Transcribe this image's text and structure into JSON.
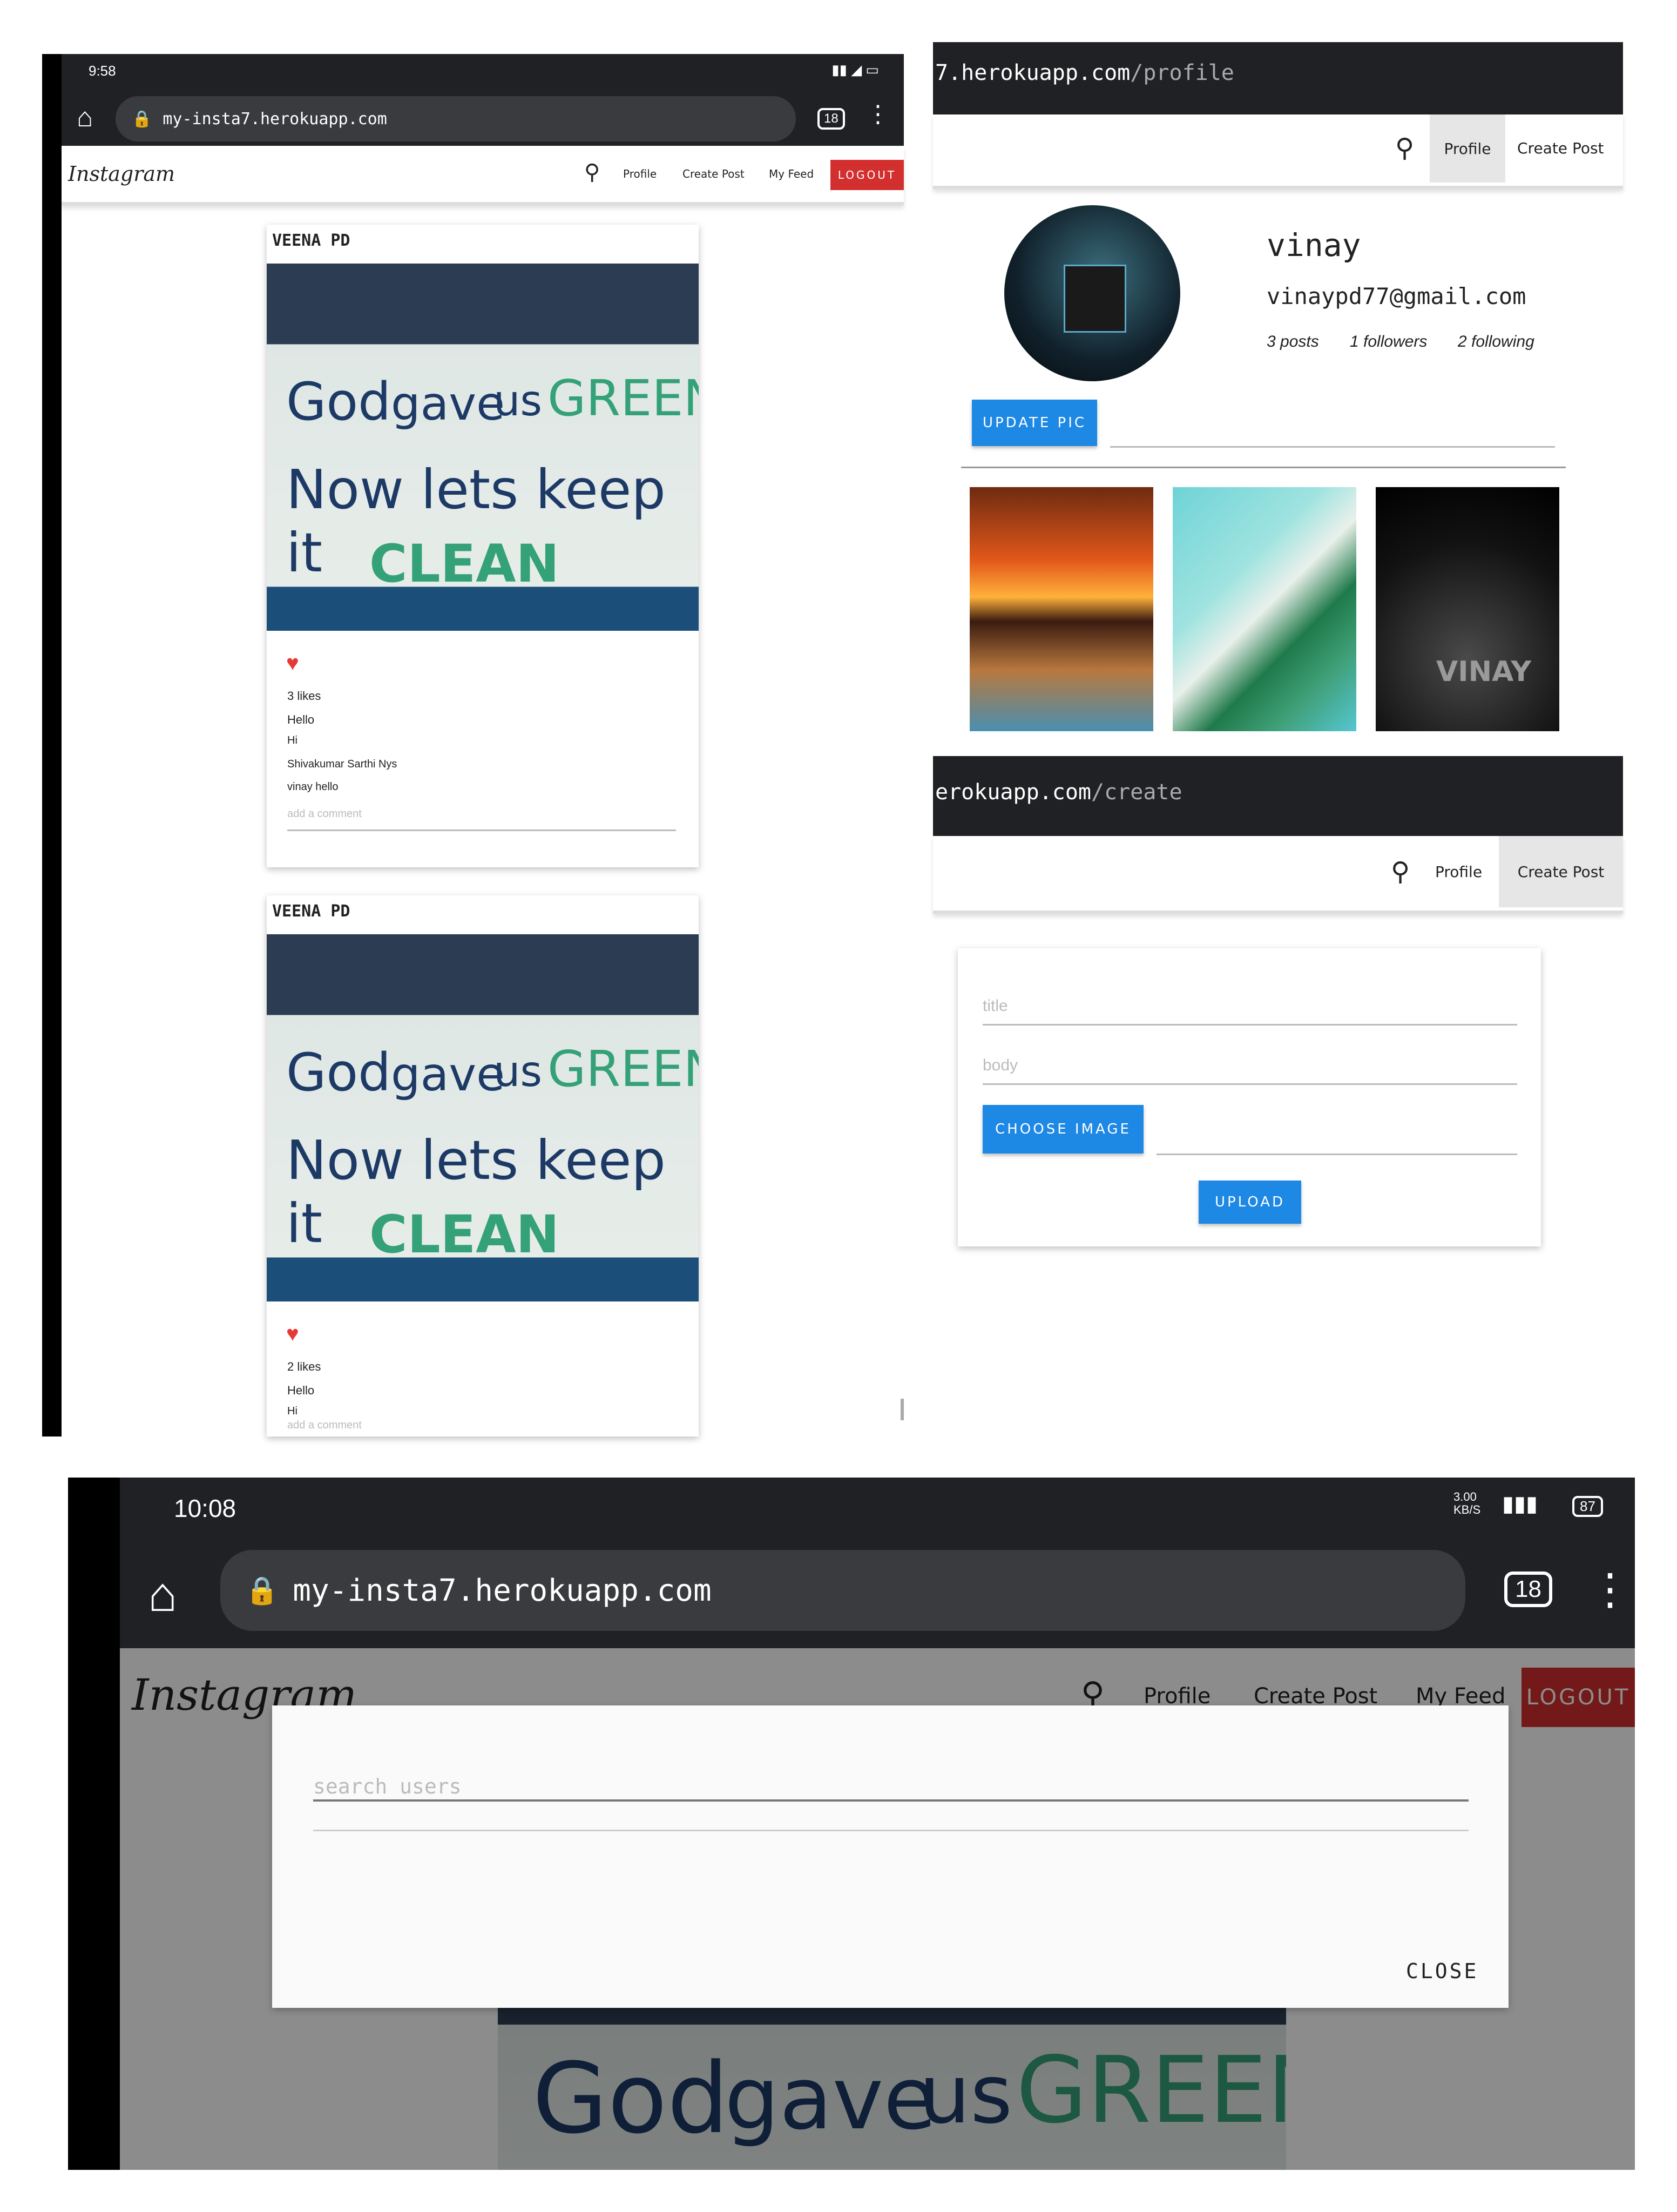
{
  "colors": {
    "accent": "#1e88e5",
    "logout": "#d32f2f",
    "dark": "#202124"
  },
  "panel_feed": {
    "status": {
      "time": "9:58",
      "icons": "signal-wifi-battery"
    },
    "url": "my-insta7.herokuapp.com",
    "tabs": "18",
    "nav": {
      "brand": "Instagram",
      "profile": "Profile",
      "create": "Create Post",
      "feed": "My Feed",
      "logout": "LOGOUT"
    },
    "posts": [
      {
        "author": "VEENA PD",
        "poster": {
          "l1a": "God",
          "l1b": "gave",
          "l1c": "us",
          "l1d": "GREEN",
          "l2": "Now lets keep it",
          "l3": "CLEAN"
        },
        "likes": "3 likes",
        "comments": [
          "Hello",
          "Hi",
          "Shivakumar Sarthi Nys",
          "vinay hello"
        ],
        "add_comment": "add a comment"
      },
      {
        "author": "VEENA PD",
        "poster": {
          "l1a": "God",
          "l1b": "gave",
          "l1c": "us",
          "l1d": "GREEN",
          "l2": "Now lets keep it",
          "l3": "CLEAN"
        },
        "likes": "2 likes",
        "comments": [
          "Hello",
          "Hi"
        ],
        "add_comment": "add a comment"
      }
    ]
  },
  "panel_profile": {
    "url_host": "7.herokuapp.com",
    "url_path": "/profile",
    "nav": {
      "profile": "Profile",
      "create": "Create Post"
    },
    "name": "vinay",
    "email": "vinaypd77@gmail.com",
    "posts": "3 posts",
    "followers": "1 followers",
    "following": "2 following",
    "update_pic": "UPDATE PIC",
    "gallery_watermark": "VINAY"
  },
  "panel_create": {
    "url_host": "erokuapp.com",
    "url_path": "/create",
    "nav": {
      "profile": "Profile",
      "create": "Create Post"
    },
    "title_placeholder": "title",
    "body_placeholder": "body",
    "choose_image": "CHOOSE IMAGE",
    "upload": "UPLOAD"
  },
  "panel_search": {
    "status": {
      "time": "10:08",
      "speed": "3.00 KB/S",
      "battery": "87"
    },
    "url": "my-insta7.herokuapp.com",
    "tabs": "18",
    "nav": {
      "brand": "Instagram",
      "profile": "Profile",
      "create": "Create Post",
      "feed": "My Feed",
      "logout": "LOGOUT"
    },
    "search_placeholder": "search users",
    "close": "CLOSE",
    "poster": {
      "l1a": "God",
      "l1b": "gave",
      "l1c": "us",
      "l1d": "GREEN"
    }
  }
}
